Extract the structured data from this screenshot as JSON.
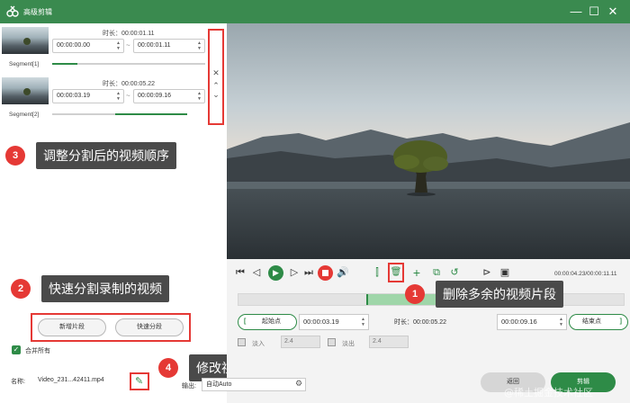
{
  "window": {
    "title": "高级剪辑"
  },
  "segments": [
    {
      "label": "Segment[1]",
      "duration_label": "时长：00:00:01.11",
      "start": "00:00:00.00",
      "end": "00:00:01.11"
    },
    {
      "label": "Segment[2]",
      "duration_label": "时长：00:00:05.22",
      "start": "00:00:03.19",
      "end": "00:00:09.16"
    }
  ],
  "segment_actions": {
    "new_segment": "新增片段",
    "quick_split": "快速分段"
  },
  "merge_all": "合并所有",
  "file": {
    "name_label": "名称:",
    "name_value": "Video_231...42411.mp4"
  },
  "player": {
    "time_readout": "00:00:04.23/00:00:11.11",
    "start_point": "起始点",
    "end_point": "结束点",
    "start_time": "00:00:03.19",
    "end_time": "00:00:09.16",
    "duration_label": "时长：00:00:05.22",
    "fade_in_label": "淡入",
    "fade_in_value": "2.4",
    "fade_out_label": "淡出",
    "fade_out_value": "2.4",
    "output_label": "输出:",
    "output_value": "自动Auto"
  },
  "buttons": {
    "back": "返回",
    "cut": "剪辑"
  },
  "annotations": [
    {
      "num": "1",
      "text": "删除多余的视频片段"
    },
    {
      "num": "2",
      "text": "快速分割录制的视频"
    },
    {
      "num": "3",
      "text": "调整分割后的视频顺序"
    },
    {
      "num": "4",
      "text": "修改视频的名称"
    }
  ],
  "watermark": "@稀土掘金技术社区",
  "colors": {
    "brand": "#3a8a4f",
    "accent": "#2e8b47",
    "highlight": "#e53935"
  }
}
